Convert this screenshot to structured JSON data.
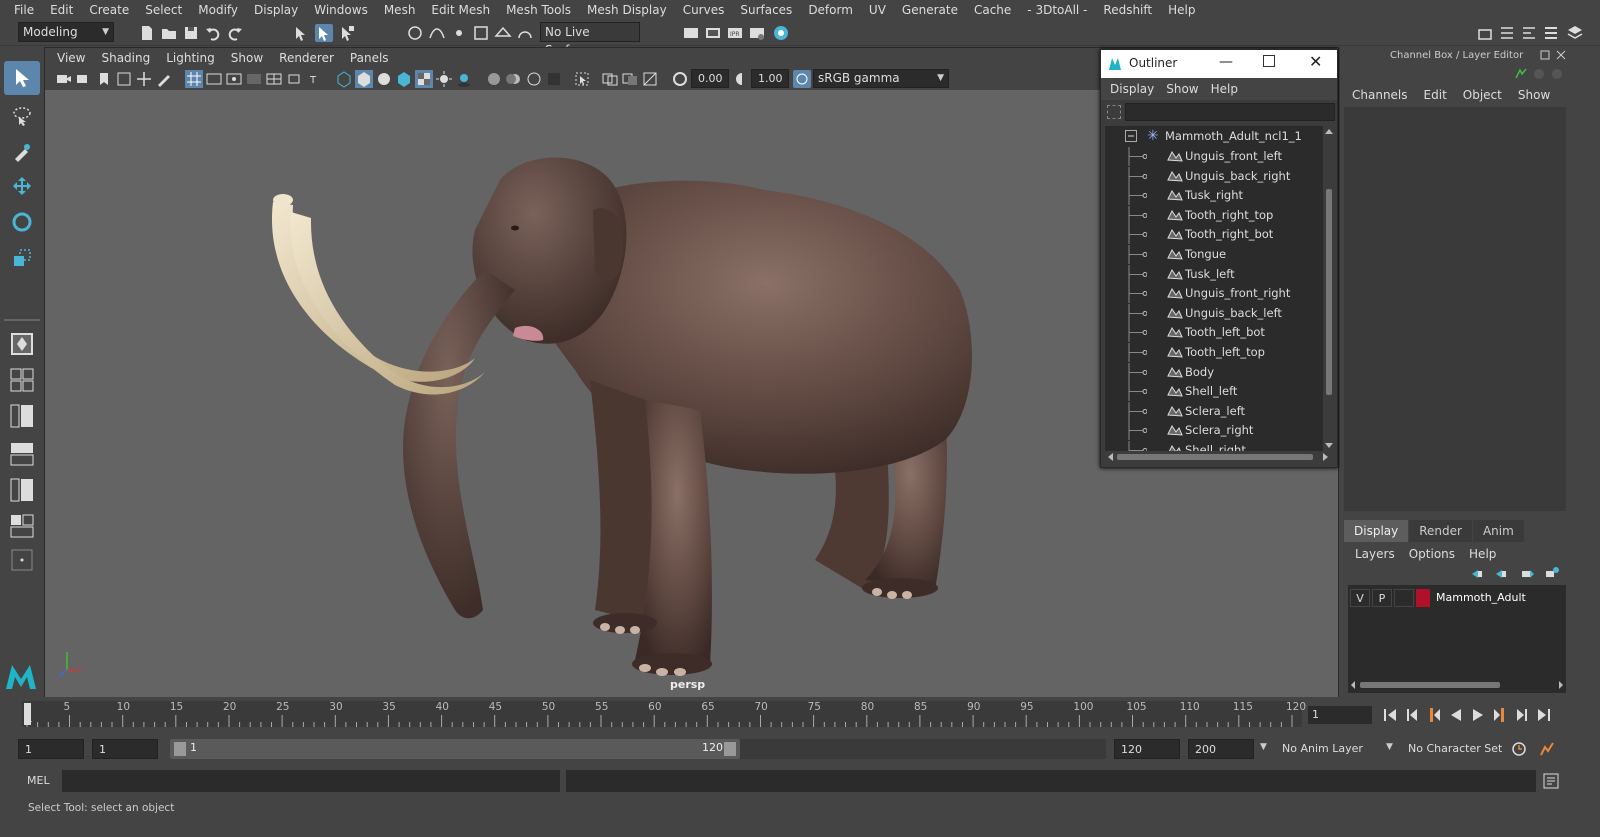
{
  "menubar": [
    "File",
    "Edit",
    "Create",
    "Select",
    "Modify",
    "Display",
    "Windows",
    "Mesh",
    "Edit Mesh",
    "Mesh Tools",
    "Mesh Display",
    "Curves",
    "Surfaces",
    "Deform",
    "UV",
    "Generate",
    "Cache",
    "- 3DtoAll -",
    "Redshift",
    "Help"
  ],
  "toolbar": {
    "workspace": "Modeling",
    "live_surface": "No Live Surface"
  },
  "viewport": {
    "menu": [
      "View",
      "Shading",
      "Lighting",
      "Show",
      "Renderer",
      "Panels"
    ],
    "exposure": "0.00",
    "gamma": "1.00",
    "color_space": "sRGB gamma",
    "camera": "persp"
  },
  "outliner": {
    "title": "Outliner",
    "menu": [
      "Display",
      "Show",
      "Help"
    ],
    "root": "Mammoth_Adult_ncl1_1",
    "items": [
      "Unguis_front_left",
      "Unguis_back_right",
      "Tusk_right",
      "Tooth_right_top",
      "Tooth_right_bot",
      "Tongue",
      "Tusk_left",
      "Unguis_front_right",
      "Unguis_back_left",
      "Tooth_left_bot",
      "Tooth_left_top",
      "Body",
      "Shell_left",
      "Sclera_left",
      "Sclera_right",
      "Shell_right"
    ]
  },
  "channel_box": {
    "title": "Channel Box / Layer Editor",
    "menu": [
      "Channels",
      "Edit",
      "Object",
      "Show"
    ]
  },
  "layer_editor": {
    "tabs": [
      "Display",
      "Render",
      "Anim"
    ],
    "menu": [
      "Layers",
      "Options",
      "Help"
    ],
    "layer": {
      "v": "V",
      "p": "P",
      "name": "Mammoth_Adult",
      "color": "#b0102a"
    }
  },
  "timeline": {
    "ticks": [
      "1",
      "5",
      "10",
      "15",
      "20",
      "25",
      "30",
      "35",
      "40",
      "45",
      "50",
      "55",
      "60",
      "65",
      "70",
      "75",
      "80",
      "85",
      "90",
      "95",
      "100",
      "105",
      "110",
      "115",
      "120"
    ],
    "current_frame": "1"
  },
  "range": {
    "start": "1",
    "playback_start": "1",
    "slider_start": "1",
    "slider_end": "120",
    "playback_end": "120",
    "end": "200",
    "anim_layer": "No Anim Layer",
    "character_set": "No Character Set"
  },
  "cmdline": {
    "label": "MEL"
  },
  "helpline": "Select Tool: select an object",
  "colors": {
    "accent": "#5c86ac",
    "viewport_bg": "#646464",
    "panel": "#444444"
  }
}
